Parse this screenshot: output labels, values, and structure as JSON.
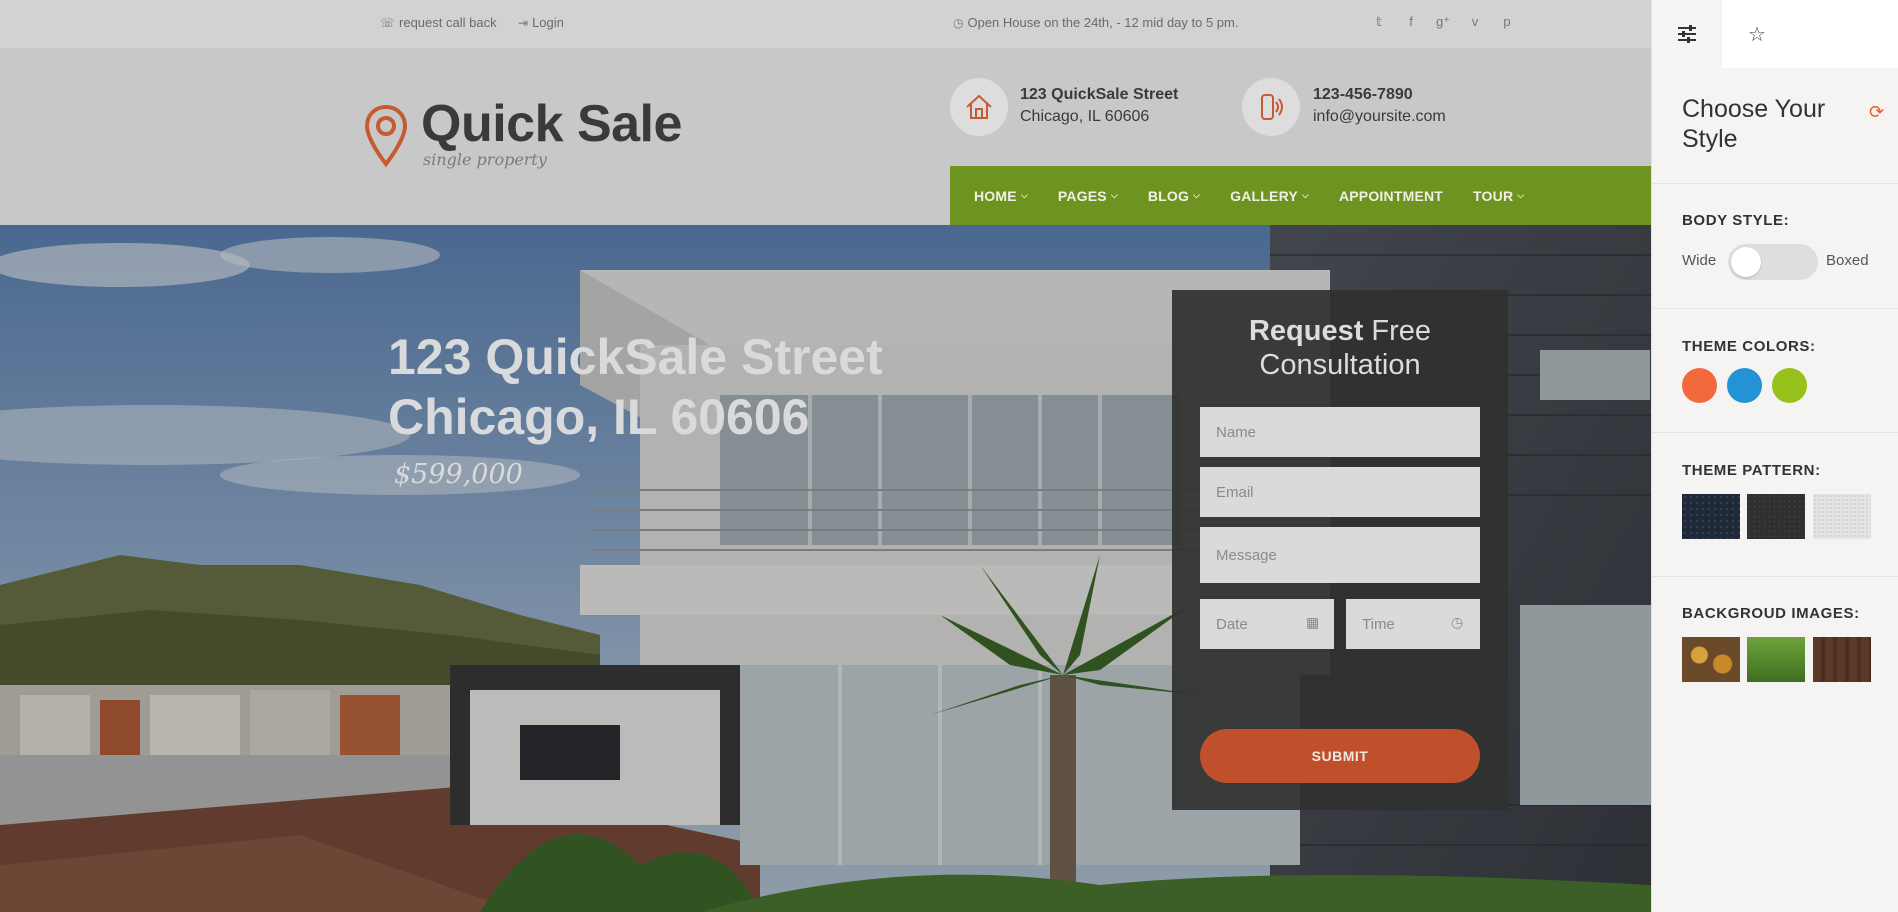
{
  "topbar": {
    "call_back": "request call back",
    "login": "Login",
    "open_house": "Open House on the 24th, - 12 mid day to 5 pm.",
    "social": [
      "twitter-icon",
      "facebook-icon",
      "google-plus-icon",
      "vimeo-icon",
      "pinterest-icon"
    ]
  },
  "logo": {
    "title": "Quick Sale",
    "subtitle": "single property"
  },
  "contact": {
    "address_line1": "123 QuickSale Street",
    "address_line2": "Chicago, IL 60606",
    "phone": "123-456-7890",
    "email": "info@yoursite.com"
  },
  "nav": [
    {
      "label": "HOME",
      "dropdown": true
    },
    {
      "label": "PAGES",
      "dropdown": true
    },
    {
      "label": "BLOG",
      "dropdown": true
    },
    {
      "label": "GALLERY",
      "dropdown": true
    },
    {
      "label": "APPOINTMENT",
      "dropdown": false
    },
    {
      "label": "TOUR",
      "dropdown": true
    }
  ],
  "hero": {
    "line1": "123 QuickSale Street",
    "line2": "Chicago, IL 60606",
    "price": "$599,000"
  },
  "form": {
    "title_bold": "Request",
    "title_rest": " Free",
    "title_line2": "Consultation",
    "name_placeholder": "Name",
    "email_placeholder": "Email",
    "message_placeholder": "Message",
    "date_placeholder": "Date",
    "time_placeholder": "Time",
    "submit": "SUBMIT"
  },
  "panel": {
    "title": "Choose Your Style",
    "body_style_label": "BODY STYLE:",
    "wide": "Wide",
    "boxed": "Boxed",
    "theme_colors_label": "THEME COLORS:",
    "theme_colors": [
      "#f26a3b",
      "#2393d6",
      "#97c11d"
    ],
    "theme_pattern_label": "THEME PATTERN:",
    "background_images_label": "BACKGROUD IMAGES:"
  }
}
